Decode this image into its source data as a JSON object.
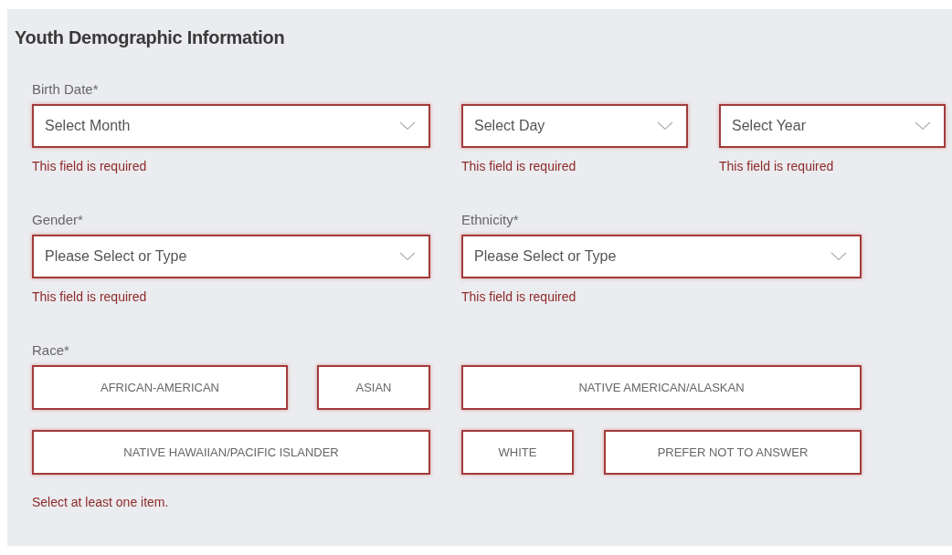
{
  "section": {
    "title": "Youth Demographic Information"
  },
  "birth_date": {
    "label": "Birth Date*",
    "selects": [
      {
        "placeholder": "Select Month",
        "invalid": true,
        "error": "This field is required"
      },
      {
        "placeholder": "Select Day",
        "invalid": true,
        "error": "This field is required"
      },
      {
        "placeholder": "Select Year",
        "invalid": true,
        "error": "This field is required"
      }
    ]
  },
  "gender": {
    "label": "Gender*",
    "placeholder": "Please Select or Type",
    "invalid": true,
    "error": "This field is required"
  },
  "ethnicity": {
    "label": "Ethnicity*",
    "placeholder": "Please Select or Type",
    "invalid": true,
    "error": "This field is required"
  },
  "race": {
    "label": "Race*",
    "invalid": true,
    "options": [
      {
        "label": "AFRICAN-AMERICAN",
        "selected": false
      },
      {
        "label": "ASIAN",
        "selected": false
      },
      {
        "label": "NATIVE AMERICAN/ALASKAN",
        "selected": false
      },
      {
        "label": "NATIVE HAWAIIAN/PACIFIC ISLANDER",
        "selected": false
      },
      {
        "label": "WHITE",
        "selected": false
      },
      {
        "label": "PREFER NOT TO ANSWER",
        "selected": false
      }
    ],
    "error": "Select at least one item."
  }
}
